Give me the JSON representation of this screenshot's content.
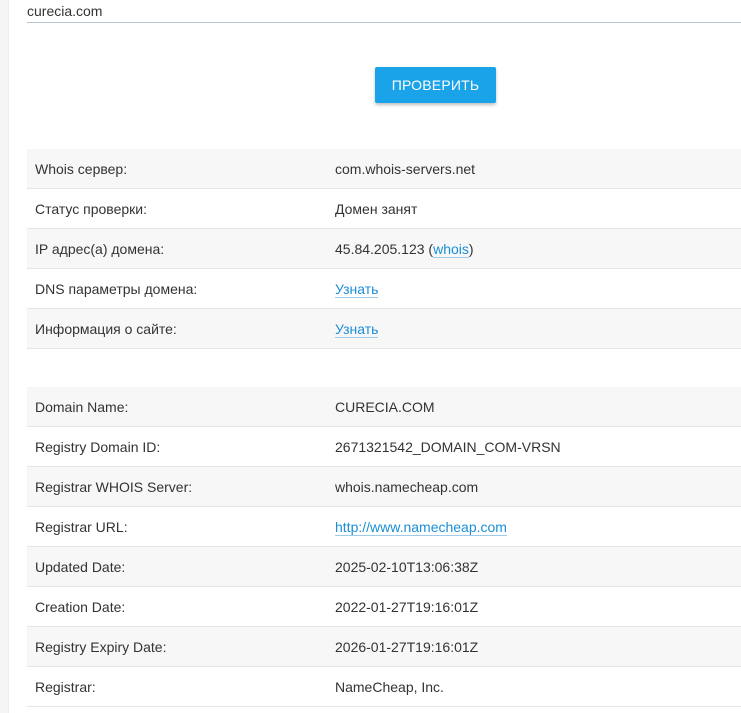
{
  "form": {
    "domain_value": "curecia.com",
    "check_label": "ПРОВЕРИТЬ"
  },
  "summary": {
    "rows": [
      {
        "label": "Whois сервер:",
        "value": "com.whois-servers.net"
      },
      {
        "label": "Статус проверки:",
        "value": "Домен занят"
      },
      {
        "label": "IP адрес(а) домена:",
        "value": "45.84.205.123",
        "open": " (",
        "link": "whois",
        "close": ")"
      },
      {
        "label": "DNS параметры домена:",
        "link": "Узнать"
      },
      {
        "label": "Информация о сайте:",
        "link": "Узнать"
      }
    ]
  },
  "whois": {
    "rows": [
      {
        "label": "Domain Name:",
        "value": "CURECIA.COM"
      },
      {
        "label": "Registry Domain ID:",
        "value": "2671321542_DOMAIN_COM-VRSN"
      },
      {
        "label": "Registrar WHOIS Server:",
        "value": "whois.namecheap.com"
      },
      {
        "label": "Registrar URL:",
        "link": "http://www.namecheap.com"
      },
      {
        "label": "Updated Date:",
        "value": "2025-02-10T13:06:38Z"
      },
      {
        "label": "Creation Date:",
        "value": "2022-01-27T19:16:01Z"
      },
      {
        "label": "Registry Expiry Date:",
        "value": "2026-01-27T19:16:01Z"
      },
      {
        "label": "Registrar:",
        "value": "NameCheap, Inc."
      }
    ]
  },
  "colors": {
    "accent": "#1aa3e8",
    "link": "#1a8fd6",
    "row_alt": "#f7f7f7"
  }
}
